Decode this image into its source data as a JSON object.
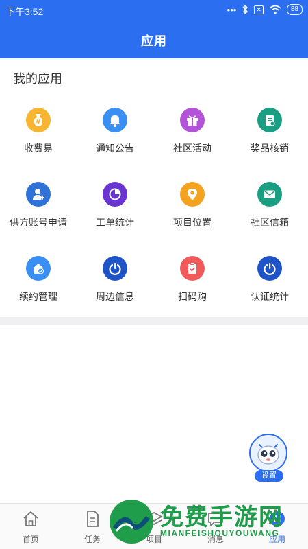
{
  "status_bar": {
    "time": "下午3:52",
    "battery": "88",
    "sim": "✕"
  },
  "header": {
    "title": "应用"
  },
  "section": {
    "title": "我的应用"
  },
  "apps": [
    {
      "label": "收费易",
      "icon": "money-bag-icon",
      "color": "#f7b531"
    },
    {
      "label": "通知公告",
      "icon": "bell-icon",
      "color": "#3a8ff2"
    },
    {
      "label": "社区活动",
      "icon": "gift-icon",
      "color": "#b253d8"
    },
    {
      "label": "奖品核销",
      "icon": "voucher-icon",
      "color": "#1a9f82"
    },
    {
      "label": "供方账号申请",
      "icon": "user-add-icon",
      "color": "#2f73d8"
    },
    {
      "label": "工单统计",
      "icon": "pie-chart-icon",
      "color": "#6a34d3"
    },
    {
      "label": "项目位置",
      "icon": "location-pin-icon",
      "color": "#f3a31f"
    },
    {
      "label": "社区信箱",
      "icon": "mail-icon",
      "color": "#1a9f82"
    },
    {
      "label": "续约管理",
      "icon": "home-check-icon",
      "color": "#3a8ff2"
    },
    {
      "label": "周边信息",
      "icon": "power-dial-icon",
      "color": "#1e54c8"
    },
    {
      "label": "扫码购",
      "icon": "clipboard-check-icon",
      "color": "#f05a5a"
    },
    {
      "label": "认证统计",
      "icon": "power-dial-icon",
      "color": "#1e54c8"
    }
  ],
  "floating_button": {
    "label": "设置",
    "icon": "robot-avatar-icon"
  },
  "tabs": [
    {
      "label": "首页",
      "icon": "home-icon",
      "active": false
    },
    {
      "label": "任务",
      "icon": "document-icon",
      "active": false
    },
    {
      "label": "项目",
      "icon": "layers-icon",
      "active": false
    },
    {
      "label": "消息",
      "icon": "chat-icon",
      "active": false
    },
    {
      "label": "应用",
      "icon": "apps-icon",
      "active": true
    }
  ],
  "watermark": {
    "title": "免费手游网",
    "subtitle": "MIANFEISHOUYOUWANG"
  },
  "colors": {
    "primary": "#2b6ff0",
    "divider": "#f0f0f2",
    "watermark": "#1f9d4a"
  }
}
